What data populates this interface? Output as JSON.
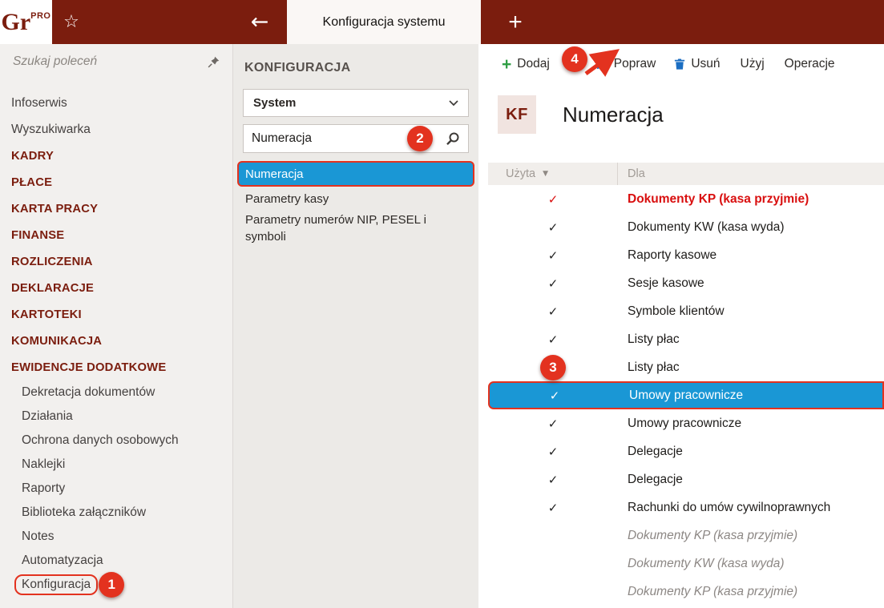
{
  "app": {
    "logo_text": "Gr",
    "logo_sup": "PRO",
    "tab_title": "Konfiguracja systemu"
  },
  "icons": {
    "star": "☆",
    "back_arrow": "←",
    "new_tab_plus": "+",
    "add_plus": "+",
    "check": "✓",
    "filter_arrow": "▼"
  },
  "colors": {
    "topbar_maroon": "#7b1d0e",
    "annotation_red": "#e3321f",
    "selection_blue": "#1a97d5",
    "used_row_red": "#d90f0f",
    "add_green": "#2f9e44",
    "tool_icon_blue": "#1b6ec2"
  },
  "sidebar": {
    "search_placeholder": "Szukaj poleceń",
    "items": [
      {
        "label": "Infoserwis",
        "type": "normal"
      },
      {
        "label": "Wyszukiwarka",
        "type": "normal"
      },
      {
        "label": "KADRY",
        "type": "section"
      },
      {
        "label": "PŁACE",
        "type": "section"
      },
      {
        "label": "KARTA PRACY",
        "type": "section"
      },
      {
        "label": "FINANSE",
        "type": "section"
      },
      {
        "label": "ROZLICZENIA",
        "type": "section"
      },
      {
        "label": "DEKLARACJE",
        "type": "section"
      },
      {
        "label": "KARTOTEKI",
        "type": "section"
      },
      {
        "label": "KOMUNIKACJA",
        "type": "section"
      },
      {
        "label": "EWIDENCJE DODATKOWE",
        "type": "section"
      },
      {
        "label": "Dekretacja dokumentów",
        "type": "sub"
      },
      {
        "label": "Działania",
        "type": "sub"
      },
      {
        "label": "Ochrona danych osobowych",
        "type": "sub"
      },
      {
        "label": "Naklejki",
        "type": "sub"
      },
      {
        "label": "Raporty",
        "type": "sub"
      },
      {
        "label": "Biblioteka załączników",
        "type": "sub"
      },
      {
        "label": "Notes",
        "type": "sub"
      },
      {
        "label": "Automatyzacja",
        "type": "sub"
      },
      {
        "label": "Konfiguracja",
        "type": "sub",
        "annotation": "1"
      }
    ]
  },
  "config_panel": {
    "title": "KONFIGURACJA",
    "dropdown_value": "System",
    "search_value": "Numeracja",
    "search_annotation": "2",
    "items": [
      {
        "label": "Numeracja",
        "selected": true
      },
      {
        "label": "Parametry kasy",
        "selected": false
      },
      {
        "label": "Parametry numerów NIP, PESEL i symboli",
        "selected": false
      }
    ]
  },
  "toolbar": {
    "add_label": "Dodaj",
    "edit_label": "Popraw",
    "delete_label": "Usuń",
    "use_label": "Użyj",
    "operations_label": "Operacje",
    "annotation": "4"
  },
  "content": {
    "badge": "KF",
    "title": "Numeracja",
    "table": {
      "col_used": "Użyta",
      "col_for": "Dla",
      "rows": [
        {
          "used": true,
          "label": "Dokumenty KP (kasa przyjmie)",
          "style": "red-bold"
        },
        {
          "used": true,
          "label": "Dokumenty KW (kasa wyda)",
          "style": "normal"
        },
        {
          "used": true,
          "label": "Raporty kasowe",
          "style": "normal"
        },
        {
          "used": true,
          "label": "Sesje kasowe",
          "style": "normal"
        },
        {
          "used": true,
          "label": "Symbole klientów",
          "style": "normal"
        },
        {
          "used": true,
          "label": "Listy płac",
          "style": "normal"
        },
        {
          "used": false,
          "label": "Listy płac",
          "style": "normal",
          "annotation": "3"
        },
        {
          "used": true,
          "label": "Umowy pracownicze",
          "style": "selected"
        },
        {
          "used": true,
          "label": "Umowy pracownicze",
          "style": "normal"
        },
        {
          "used": true,
          "label": "Delegacje",
          "style": "normal"
        },
        {
          "used": true,
          "label": "Delegacje",
          "style": "normal"
        },
        {
          "used": true,
          "label": "Rachunki do umów cywilnoprawnych",
          "style": "normal"
        },
        {
          "used": false,
          "label": "Dokumenty KP (kasa przyjmie)",
          "style": "italic-gray"
        },
        {
          "used": false,
          "label": "Dokumenty KW (kasa wyda)",
          "style": "italic-gray"
        },
        {
          "used": false,
          "label": "Dokumenty KP (kasa przyjmie)",
          "style": "italic-gray"
        }
      ]
    }
  }
}
